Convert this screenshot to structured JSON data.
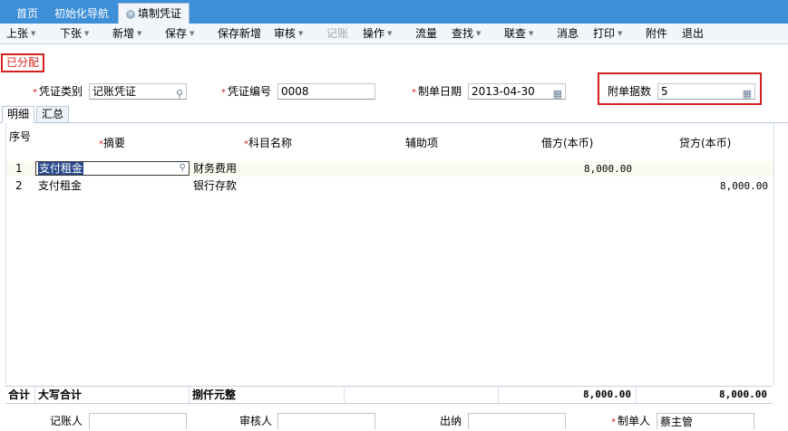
{
  "tabs": [
    {
      "label": "首页"
    },
    {
      "label": "初始化导航"
    },
    {
      "label": "填制凭证"
    }
  ],
  "toolbar": [
    {
      "label": "上张",
      "dropdown": true
    },
    {
      "label": "下张",
      "dropdown": true
    },
    {
      "label": "新增",
      "dropdown": true
    },
    {
      "label": "保存",
      "dropdown": true
    },
    {
      "label": "保存新增",
      "dropdown": false
    },
    {
      "label": "审核",
      "dropdown": true
    },
    {
      "label": "记账",
      "dropdown": false,
      "disabled": true
    },
    {
      "label": "操作",
      "dropdown": true
    },
    {
      "label": "流量",
      "dropdown": false
    },
    {
      "label": "查找",
      "dropdown": true
    },
    {
      "label": "联查",
      "dropdown": true
    },
    {
      "label": "消息",
      "dropdown": false
    },
    {
      "label": "打印",
      "dropdown": true
    },
    {
      "label": "附件",
      "dropdown": false
    },
    {
      "label": "退出",
      "dropdown": false
    }
  ],
  "status": "已分配",
  "form": {
    "voucher_type_label": "凭证类别",
    "voucher_type_value": "记账凭证",
    "voucher_no_label": "凭证编号",
    "voucher_no_value": "0008",
    "date_label": "制单日期",
    "date_value": "2013-04-30",
    "attach_label": "附单据数",
    "attach_value": "5"
  },
  "subtabs": [
    {
      "label": "明细"
    },
    {
      "label": "汇总"
    }
  ],
  "columns": {
    "seq": "序号",
    "summary": "摘要",
    "account": "科目名称",
    "aux": "辅助项",
    "debit": "借方(本币)",
    "credit": "贷方(本币)"
  },
  "rows": [
    {
      "seq": "1",
      "summary": "支付租金",
      "account": "财务费用",
      "aux": "",
      "debit": "8,000.00",
      "credit": ""
    },
    {
      "seq": "2",
      "summary": "支付租金",
      "account": "银行存款",
      "aux": "",
      "debit": "",
      "credit": "8,000.00"
    }
  ],
  "total": {
    "label": "合计",
    "caps_label": "大写合计",
    "caps_value": "捌仟元整",
    "debit": "8,000.00",
    "credit": "8,000.00"
  },
  "footer": {
    "bookkeeper_label": "记账人",
    "bookkeeper_value": "",
    "auditor_label": "审核人",
    "auditor_value": "",
    "cashier_label": "出纳",
    "cashier_value": "",
    "maker_label": "制单人",
    "maker_value": "蔡主管"
  },
  "colors": {
    "tabbar": "#3d8fd8",
    "highlight": "#d42020",
    "selection": "#2a4a8c"
  },
  "icons": {
    "lookup": "magnifier-icon",
    "calendar": "calendar-icon",
    "close_tab": "close-icon",
    "dropdown": "chevron-down-icon"
  }
}
